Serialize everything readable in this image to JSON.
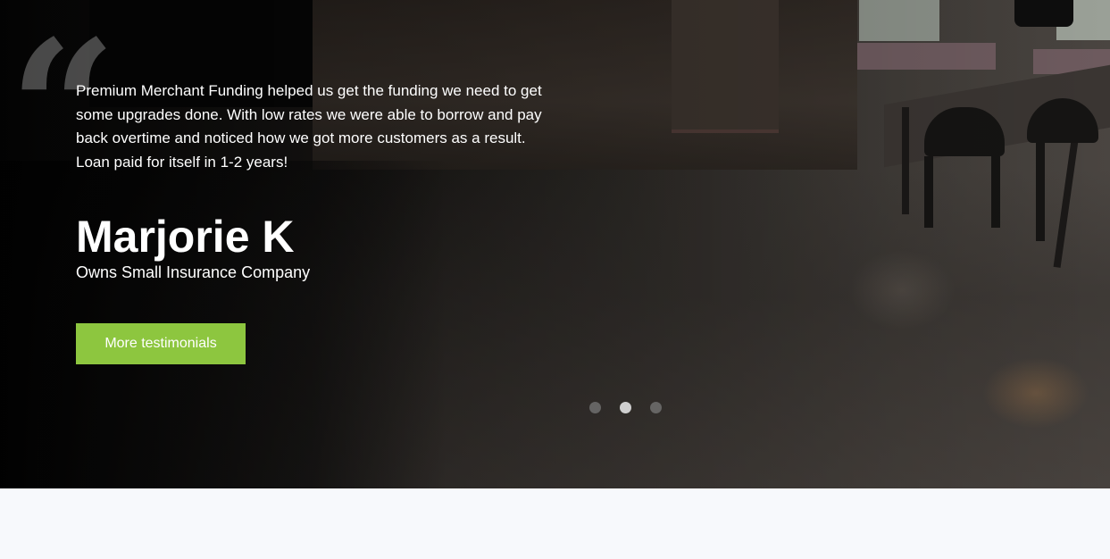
{
  "testimonial": {
    "quote_icon": "quote-open-icon",
    "quote_glyph": "“",
    "text": "Premium Merchant Funding helped us get the funding we need to get some upgrades done. With low rates we were able to borrow and pay back overtime and noticed how we got more customers as a result. Loan paid for itself in 1-2 years!",
    "author_name": "Marjorie K",
    "author_role": "Owns Small Insurance Company"
  },
  "cta": {
    "label": "More testimonials",
    "color": "#8dc63f"
  },
  "carousel": {
    "slide_count": 3,
    "active_index": 1
  }
}
